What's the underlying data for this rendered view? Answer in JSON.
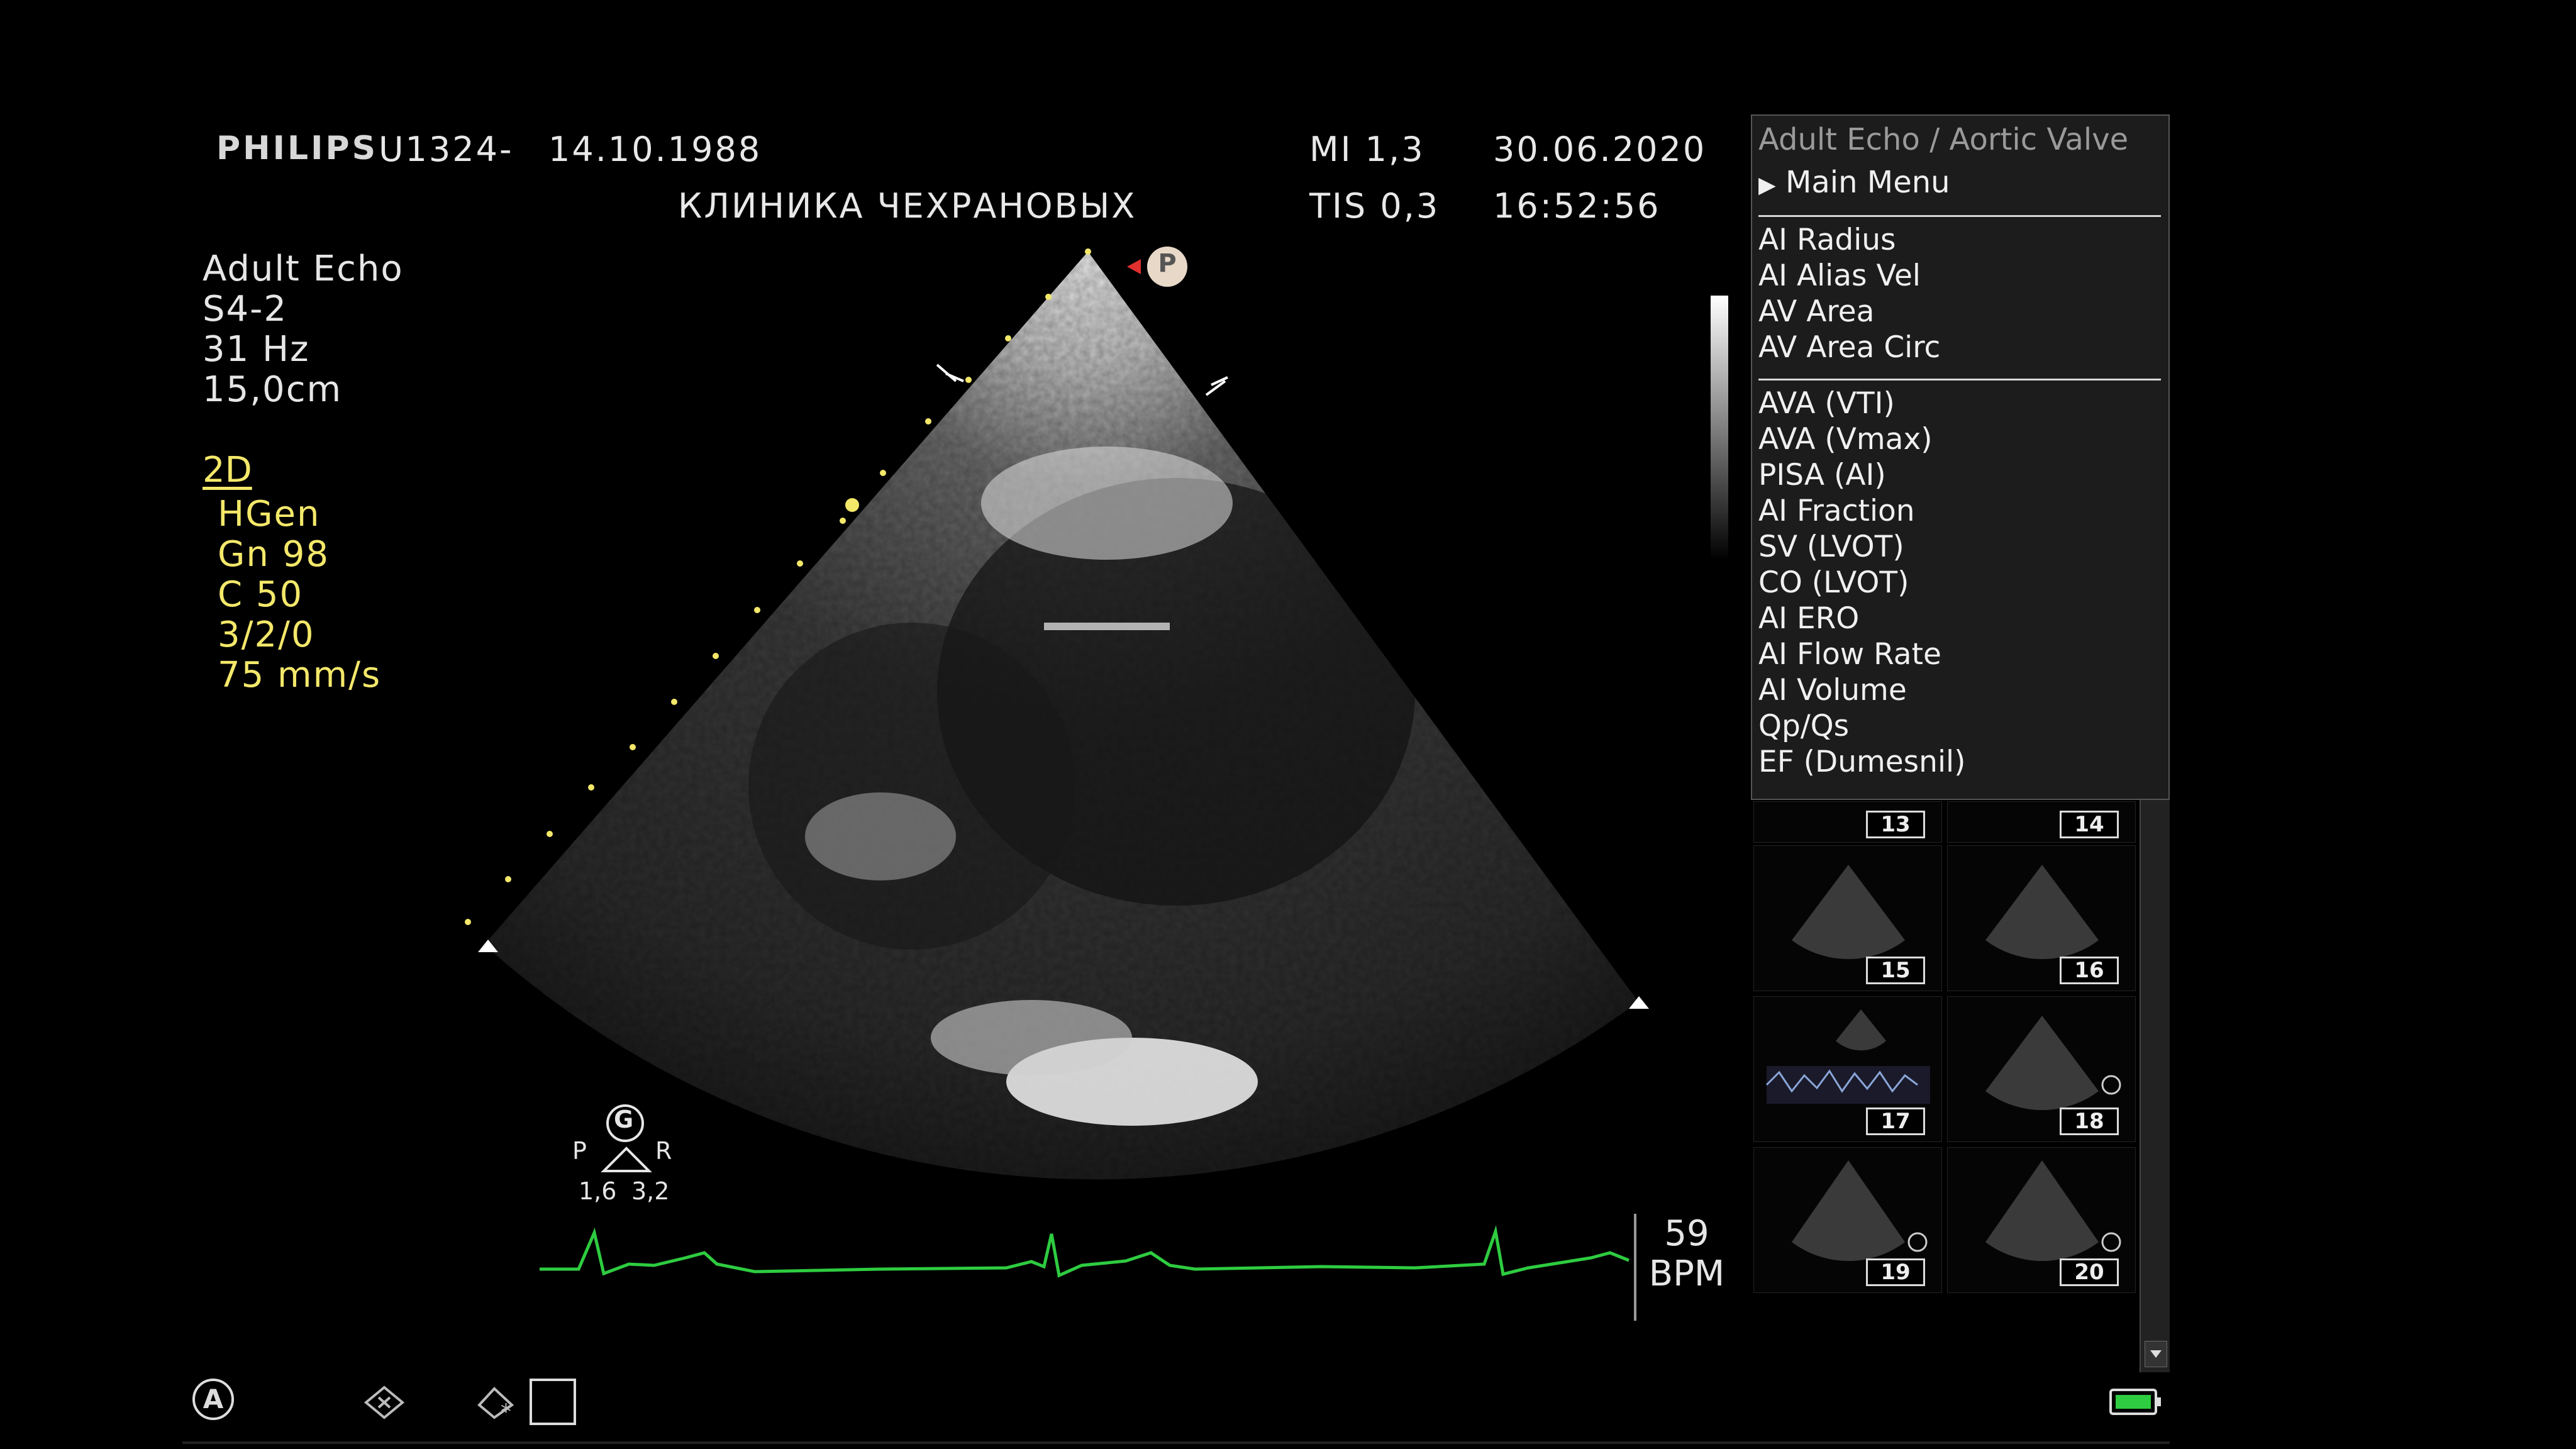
{
  "header": {
    "brand": "PHILIPS",
    "patient_id": "U1324-",
    "birth_date": "14.10.1988",
    "clinic": "КЛИНИКА ЧЕХРАНОВЫХ",
    "mi": "MI 1,3",
    "tis": "TIS 0,3",
    "date": "30.06.2020",
    "time": "16:52:56"
  },
  "left_info": {
    "preset": "Adult Echo",
    "probe": "S4-2",
    "frame_rate": "31 Hz",
    "depth": "15,0cm",
    "mode": "2D",
    "params": [
      "HGen",
      "Gn 98",
      "C 50",
      "3/2/0",
      "75 mm/s"
    ]
  },
  "scan": {
    "marker": "P",
    "orientation_marker": "G",
    "left_label": "P",
    "right_label": "R",
    "left_value": "1,6",
    "right_value": "3,2"
  },
  "ecg": {
    "heart_rate": "59",
    "unit": "BPM",
    "color": "#2ecc40"
  },
  "menu": {
    "title": "Adult Echo / Aortic Valve",
    "main_menu": "Main Menu",
    "group1": [
      "AI Radius",
      "AI Alias Vel",
      "AV Area",
      "AV Area Circ"
    ],
    "group2": [
      "AVA (VTI)",
      "AVA (Vmax)",
      "PISA (AI)",
      "AI Fraction",
      "SV (LVOT)",
      "CO (LVOT)",
      "AI ERO",
      "AI Flow Rate",
      "AI Volume",
      "Qp/Qs",
      "EF (Dumesnil)"
    ]
  },
  "thumbnails": [
    "13",
    "14",
    "15",
    "16",
    "17",
    "18",
    "19",
    "20"
  ],
  "bottom_bar": {
    "annotate_icon": "A",
    "icons": [
      "annotation-circle-icon",
      "clear-icon",
      "label-icon",
      "square-icon",
      "battery-icon"
    ]
  }
}
